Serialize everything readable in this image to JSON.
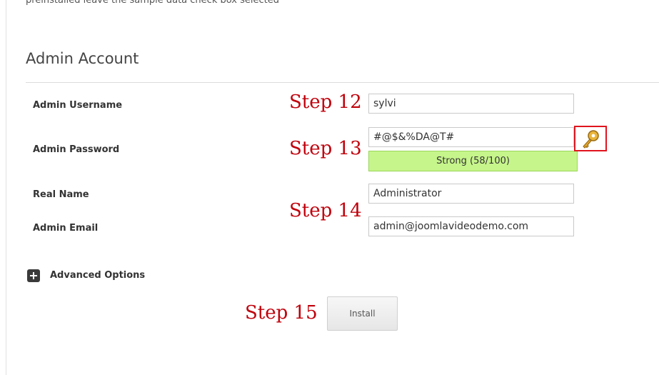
{
  "top_cut_text": "preinstalled leave the sample data check box selected",
  "section": {
    "title": "Admin Account"
  },
  "fields": {
    "username": {
      "label": "Admin Username",
      "value": "sylvi"
    },
    "password": {
      "label": "Admin Password",
      "value": "#@$&%DA@T#",
      "strength": "Strong (58/100)"
    },
    "real_name": {
      "label": "Real Name",
      "value": "Administrator"
    },
    "email": {
      "label": "Admin Email",
      "value": "admin@joomlavideodemo.com"
    }
  },
  "steps": {
    "s12": "Step 12",
    "s13": "Step 13",
    "s14": "Step 14",
    "s15": "Step 15"
  },
  "advanced": {
    "label": "Advanced Options",
    "icon": "plus-icon"
  },
  "install": {
    "label": "Install"
  },
  "icons": {
    "generate_password": "key-icon"
  },
  "colors": {
    "step_annotation": "#c0000b",
    "highlight_border": "#e0141e",
    "strength_bar": "#c6f58b"
  }
}
